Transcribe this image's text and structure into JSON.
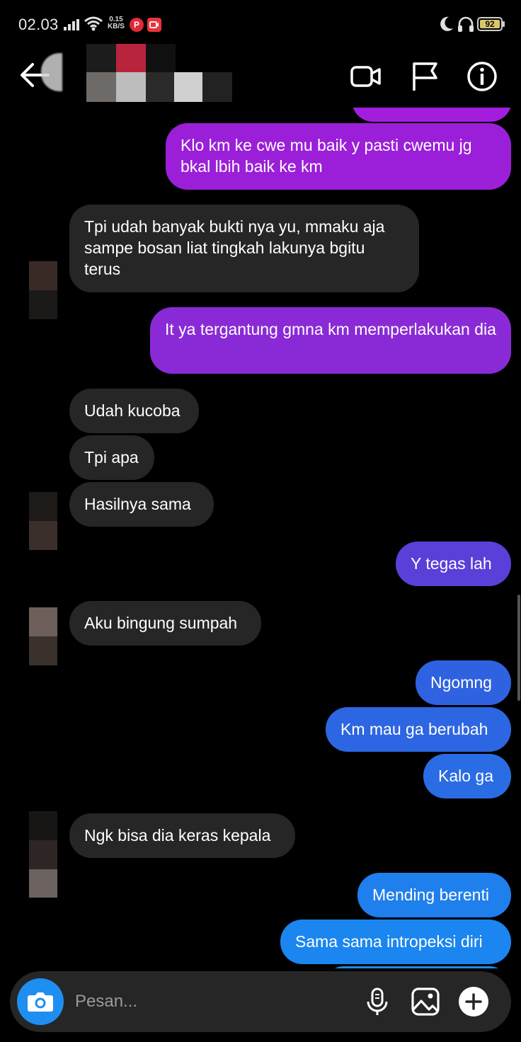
{
  "status_bar": {
    "time": "02.03",
    "net_speed_value": "0.15",
    "net_speed_unit": "KB/S",
    "battery": "92",
    "icons": [
      "signal-icon",
      "wifi-icon",
      "pinterest-icon",
      "screen-record-icon",
      "moon-icon",
      "headset-icon",
      "battery-icon"
    ]
  },
  "header": {
    "icons": [
      "back-arrow-icon",
      "video-call-icon",
      "flag-icon",
      "info-icon"
    ]
  },
  "messages": [
    {
      "sender": "me",
      "text": "Klo km ke cwe mu baik y pasti cwemu jg bkal lbih baik ke km",
      "color": "#9b1fd9"
    },
    {
      "sender": "them",
      "text": "Tpi udah banyak bukti nya yu, mmaku aja sampe bosan liat tingkah lakunya bgitu terus"
    },
    {
      "sender": "me",
      "text": "It ya tergantung gmna km memperlakukan dia",
      "color": "#8a2ad6"
    },
    {
      "sender": "them",
      "text": "Udah kucoba"
    },
    {
      "sender": "them",
      "text": "Tpi apa"
    },
    {
      "sender": "them",
      "text": "Hasilnya sama"
    },
    {
      "sender": "me",
      "text": "Y tegas lah",
      "color": "#5a3fd8"
    },
    {
      "sender": "them",
      "text": "Aku bingung sumpah"
    },
    {
      "sender": "me",
      "text": "Ngomng",
      "color": "#2f62e0"
    },
    {
      "sender": "me",
      "text": "Km mau ga berubah",
      "color": "#2d66e2"
    },
    {
      "sender": "me",
      "text": "Kalo ga",
      "color": "#2a6ce4"
    },
    {
      "sender": "them",
      "text": "Ngk bisa dia keras kepala"
    },
    {
      "sender": "me",
      "text": "Mending berenti",
      "color": "#1f7fec"
    },
    {
      "sender": "me",
      "text": "Sama sama intropeksi diri",
      "color": "#1b86ef"
    }
  ],
  "composer": {
    "placeholder": "Pesan...",
    "icons": [
      "camera-icon",
      "microphone-icon",
      "gallery-icon",
      "plus-icon"
    ]
  },
  "colors": {
    "background": "#000000",
    "incoming_bubble": "#262626",
    "camera_button": "#1f8ef1",
    "sent_top": "#9b1fd9",
    "sent_bottom": "#1b86ef"
  }
}
